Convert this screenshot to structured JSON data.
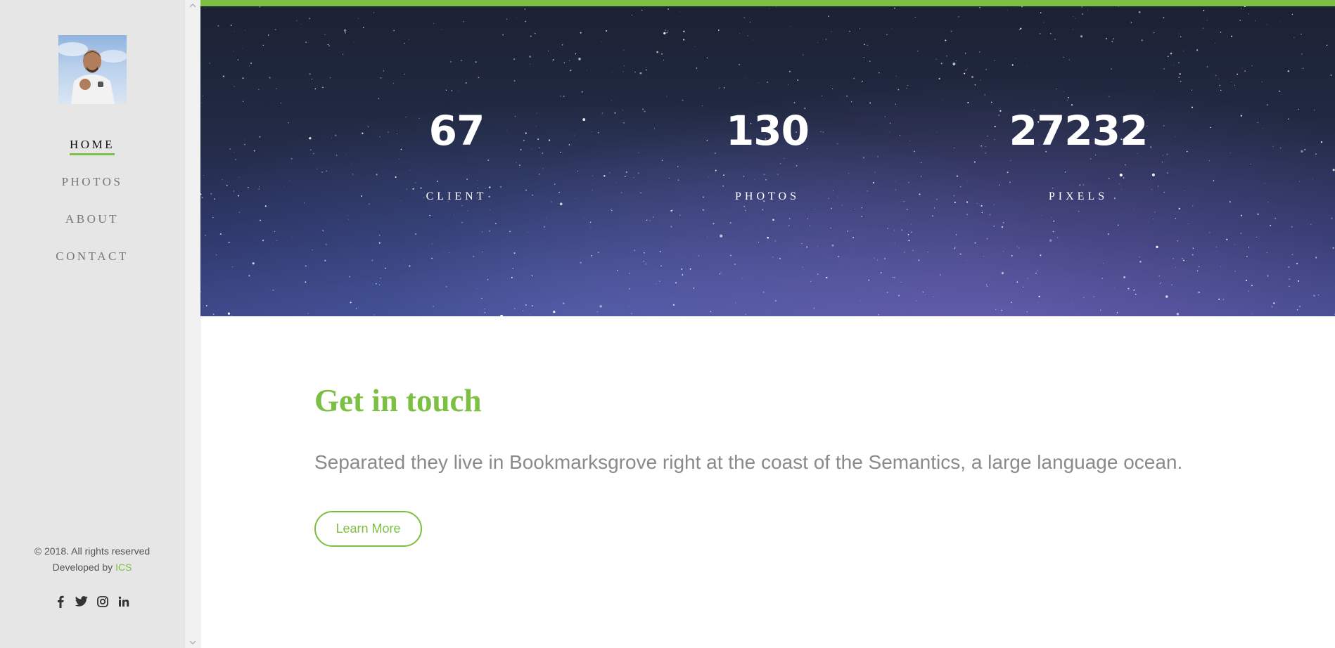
{
  "sidebar": {
    "avatar_alt": "profile photo",
    "nav": [
      {
        "label": "HOME",
        "active": true
      },
      {
        "label": "PHOTOS",
        "active": false
      },
      {
        "label": "ABOUT",
        "active": false
      },
      {
        "label": "CONTACT",
        "active": false
      }
    ],
    "copyright": "© 2018. All rights reserved",
    "developed_prefix": "Developed by ",
    "developed_link": "ICS",
    "social_icons": [
      "facebook-icon",
      "twitter-icon",
      "instagram-icon",
      "linkedin-icon"
    ]
  },
  "hero": {
    "stats": [
      {
        "value": "67",
        "label": "CLIENT"
      },
      {
        "value": "130",
        "label": "PHOTOS"
      },
      {
        "value": "27232",
        "label": "PIXELS"
      }
    ]
  },
  "contact": {
    "title": "Get in touch",
    "text": "Separated they live in Bookmarksgrove right at the coast of the Semantics, a large language ocean.",
    "button": "Learn More"
  },
  "colors": {
    "accent": "#7cc043",
    "sidebar_bg": "#e6e6e6",
    "hero_bg": "#222a44",
    "text_muted": "#8a8a8a"
  }
}
